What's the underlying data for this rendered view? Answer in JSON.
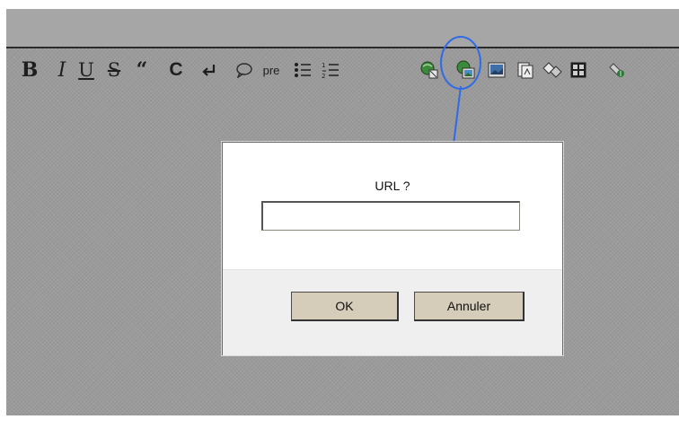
{
  "toolbar": {
    "bold": "B",
    "italic": "I",
    "underline": "U",
    "strike": "S",
    "quote": "“",
    "code": "C",
    "pre": "pre",
    "icons": [
      "bold-icon",
      "italic-icon",
      "underline-icon",
      "strikethrough-icon",
      "quote-icon",
      "code-icon",
      "line-break-icon",
      "comment-icon",
      "pre-icon",
      "bullet-list-icon",
      "numbered-list-icon",
      "link-icon",
      "image-link-icon",
      "image-icon",
      "document-icon",
      "diamond-icon",
      "table-icon",
      "tag-icon"
    ]
  },
  "dialog": {
    "prompt": "URL ?",
    "input_value": "",
    "ok_label": "OK",
    "cancel_label": "Annuler"
  },
  "colors": {
    "background": "#9b9b9b",
    "highlight": "#2f6be6",
    "button_face": "#d5cdb9"
  }
}
